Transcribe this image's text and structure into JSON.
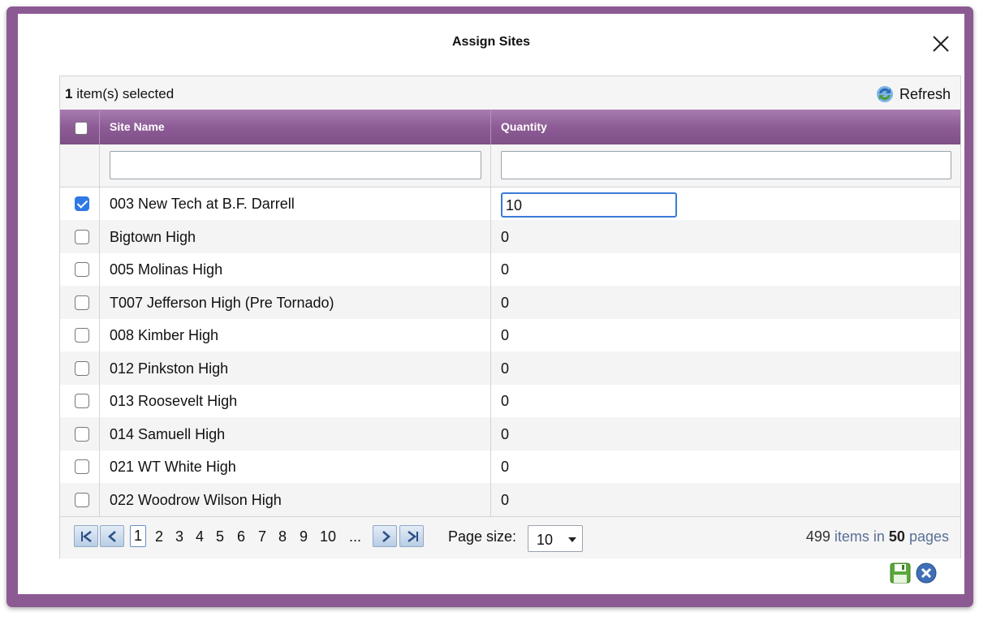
{
  "dialog": {
    "title": "Assign Sites"
  },
  "toolbar": {
    "selected_count": "1",
    "selected_suffix": " item(s) selected",
    "refresh_label": "Refresh"
  },
  "columns": {
    "site_name": "Site Name",
    "quantity": "Quantity"
  },
  "filters": {
    "site_name_value": "",
    "quantity_value": ""
  },
  "rows": [
    {
      "checked": true,
      "site": "003 New Tech at B.F. Darrell",
      "qty": "10",
      "editing": true
    },
    {
      "checked": false,
      "site": "Bigtown High",
      "qty": "0"
    },
    {
      "checked": false,
      "site": "005 Molinas High",
      "qty": "0"
    },
    {
      "checked": false,
      "site": "T007 Jefferson High (Pre Tornado)",
      "qty": "0"
    },
    {
      "checked": false,
      "site": "008 Kimber High",
      "qty": "0"
    },
    {
      "checked": false,
      "site": "012 Pinkston High",
      "qty": "0"
    },
    {
      "checked": false,
      "site": "013 Roosevelt High",
      "qty": "0"
    },
    {
      "checked": false,
      "site": "014 Samuell High",
      "qty": "0"
    },
    {
      "checked": false,
      "site": "021 WT White High",
      "qty": "0"
    },
    {
      "checked": false,
      "site": "022 Woodrow Wilson High",
      "qty": "0"
    }
  ],
  "pager": {
    "pages": [
      "1",
      "2",
      "3",
      "4",
      "5",
      "6",
      "7",
      "8",
      "9",
      "10",
      "..."
    ],
    "current_page": "1",
    "page_size_label": "Page size:",
    "page_size_value": "10",
    "total_items": "499",
    "items_in_text": " items in ",
    "total_pages": "50",
    "pages_text": " pages"
  },
  "icons": {
    "close": "close-icon",
    "refresh": "refresh-icon",
    "save": "save-icon",
    "cancel": "cancel-icon"
  },
  "colors": {
    "frame": "#8c5a93",
    "header": "#8d5c96",
    "accent_blue": "#2f79e6"
  }
}
